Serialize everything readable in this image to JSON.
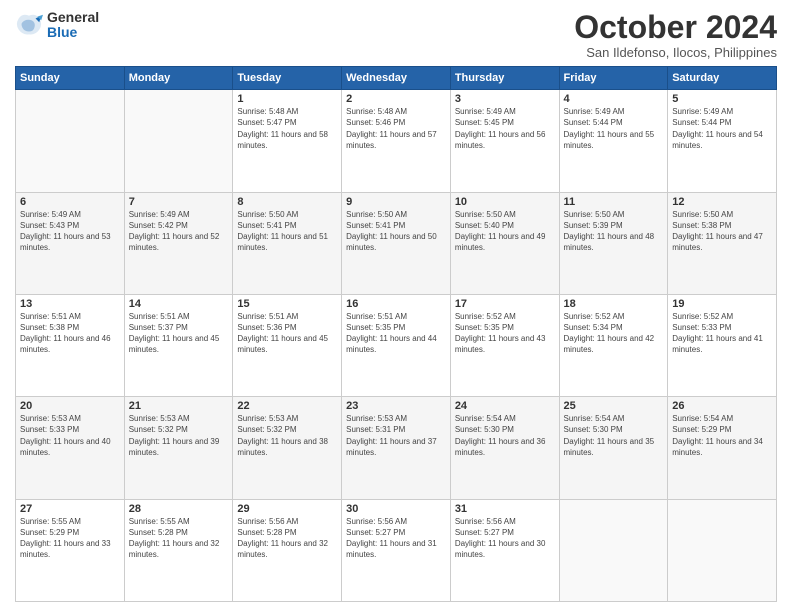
{
  "logo": {
    "general": "General",
    "blue": "Blue"
  },
  "header": {
    "month": "October 2024",
    "location": "San Ildefonso, Ilocos, Philippines"
  },
  "days_of_week": [
    "Sunday",
    "Monday",
    "Tuesday",
    "Wednesday",
    "Thursday",
    "Friday",
    "Saturday"
  ],
  "weeks": [
    [
      {
        "day": "",
        "sunrise": "",
        "sunset": "",
        "daylight": ""
      },
      {
        "day": "",
        "sunrise": "",
        "sunset": "",
        "daylight": ""
      },
      {
        "day": "1",
        "sunrise": "Sunrise: 5:48 AM",
        "sunset": "Sunset: 5:47 PM",
        "daylight": "Daylight: 11 hours and 58 minutes."
      },
      {
        "day": "2",
        "sunrise": "Sunrise: 5:48 AM",
        "sunset": "Sunset: 5:46 PM",
        "daylight": "Daylight: 11 hours and 57 minutes."
      },
      {
        "day": "3",
        "sunrise": "Sunrise: 5:49 AM",
        "sunset": "Sunset: 5:45 PM",
        "daylight": "Daylight: 11 hours and 56 minutes."
      },
      {
        "day": "4",
        "sunrise": "Sunrise: 5:49 AM",
        "sunset": "Sunset: 5:44 PM",
        "daylight": "Daylight: 11 hours and 55 minutes."
      },
      {
        "day": "5",
        "sunrise": "Sunrise: 5:49 AM",
        "sunset": "Sunset: 5:44 PM",
        "daylight": "Daylight: 11 hours and 54 minutes."
      }
    ],
    [
      {
        "day": "6",
        "sunrise": "Sunrise: 5:49 AM",
        "sunset": "Sunset: 5:43 PM",
        "daylight": "Daylight: 11 hours and 53 minutes."
      },
      {
        "day": "7",
        "sunrise": "Sunrise: 5:49 AM",
        "sunset": "Sunset: 5:42 PM",
        "daylight": "Daylight: 11 hours and 52 minutes."
      },
      {
        "day": "8",
        "sunrise": "Sunrise: 5:50 AM",
        "sunset": "Sunset: 5:41 PM",
        "daylight": "Daylight: 11 hours and 51 minutes."
      },
      {
        "day": "9",
        "sunrise": "Sunrise: 5:50 AM",
        "sunset": "Sunset: 5:41 PM",
        "daylight": "Daylight: 11 hours and 50 minutes."
      },
      {
        "day": "10",
        "sunrise": "Sunrise: 5:50 AM",
        "sunset": "Sunset: 5:40 PM",
        "daylight": "Daylight: 11 hours and 49 minutes."
      },
      {
        "day": "11",
        "sunrise": "Sunrise: 5:50 AM",
        "sunset": "Sunset: 5:39 PM",
        "daylight": "Daylight: 11 hours and 48 minutes."
      },
      {
        "day": "12",
        "sunrise": "Sunrise: 5:50 AM",
        "sunset": "Sunset: 5:38 PM",
        "daylight": "Daylight: 11 hours and 47 minutes."
      }
    ],
    [
      {
        "day": "13",
        "sunrise": "Sunrise: 5:51 AM",
        "sunset": "Sunset: 5:38 PM",
        "daylight": "Daylight: 11 hours and 46 minutes."
      },
      {
        "day": "14",
        "sunrise": "Sunrise: 5:51 AM",
        "sunset": "Sunset: 5:37 PM",
        "daylight": "Daylight: 11 hours and 45 minutes."
      },
      {
        "day": "15",
        "sunrise": "Sunrise: 5:51 AM",
        "sunset": "Sunset: 5:36 PM",
        "daylight": "Daylight: 11 hours and 45 minutes."
      },
      {
        "day": "16",
        "sunrise": "Sunrise: 5:51 AM",
        "sunset": "Sunset: 5:35 PM",
        "daylight": "Daylight: 11 hours and 44 minutes."
      },
      {
        "day": "17",
        "sunrise": "Sunrise: 5:52 AM",
        "sunset": "Sunset: 5:35 PM",
        "daylight": "Daylight: 11 hours and 43 minutes."
      },
      {
        "day": "18",
        "sunrise": "Sunrise: 5:52 AM",
        "sunset": "Sunset: 5:34 PM",
        "daylight": "Daylight: 11 hours and 42 minutes."
      },
      {
        "day": "19",
        "sunrise": "Sunrise: 5:52 AM",
        "sunset": "Sunset: 5:33 PM",
        "daylight": "Daylight: 11 hours and 41 minutes."
      }
    ],
    [
      {
        "day": "20",
        "sunrise": "Sunrise: 5:53 AM",
        "sunset": "Sunset: 5:33 PM",
        "daylight": "Daylight: 11 hours and 40 minutes."
      },
      {
        "day": "21",
        "sunrise": "Sunrise: 5:53 AM",
        "sunset": "Sunset: 5:32 PM",
        "daylight": "Daylight: 11 hours and 39 minutes."
      },
      {
        "day": "22",
        "sunrise": "Sunrise: 5:53 AM",
        "sunset": "Sunset: 5:32 PM",
        "daylight": "Daylight: 11 hours and 38 minutes."
      },
      {
        "day": "23",
        "sunrise": "Sunrise: 5:53 AM",
        "sunset": "Sunset: 5:31 PM",
        "daylight": "Daylight: 11 hours and 37 minutes."
      },
      {
        "day": "24",
        "sunrise": "Sunrise: 5:54 AM",
        "sunset": "Sunset: 5:30 PM",
        "daylight": "Daylight: 11 hours and 36 minutes."
      },
      {
        "day": "25",
        "sunrise": "Sunrise: 5:54 AM",
        "sunset": "Sunset: 5:30 PM",
        "daylight": "Daylight: 11 hours and 35 minutes."
      },
      {
        "day": "26",
        "sunrise": "Sunrise: 5:54 AM",
        "sunset": "Sunset: 5:29 PM",
        "daylight": "Daylight: 11 hours and 34 minutes."
      }
    ],
    [
      {
        "day": "27",
        "sunrise": "Sunrise: 5:55 AM",
        "sunset": "Sunset: 5:29 PM",
        "daylight": "Daylight: 11 hours and 33 minutes."
      },
      {
        "day": "28",
        "sunrise": "Sunrise: 5:55 AM",
        "sunset": "Sunset: 5:28 PM",
        "daylight": "Daylight: 11 hours and 32 minutes."
      },
      {
        "day": "29",
        "sunrise": "Sunrise: 5:56 AM",
        "sunset": "Sunset: 5:28 PM",
        "daylight": "Daylight: 11 hours and 32 minutes."
      },
      {
        "day": "30",
        "sunrise": "Sunrise: 5:56 AM",
        "sunset": "Sunset: 5:27 PM",
        "daylight": "Daylight: 11 hours and 31 minutes."
      },
      {
        "day": "31",
        "sunrise": "Sunrise: 5:56 AM",
        "sunset": "Sunset: 5:27 PM",
        "daylight": "Daylight: 11 hours and 30 minutes."
      },
      {
        "day": "",
        "sunrise": "",
        "sunset": "",
        "daylight": ""
      },
      {
        "day": "",
        "sunrise": "",
        "sunset": "",
        "daylight": ""
      }
    ]
  ]
}
